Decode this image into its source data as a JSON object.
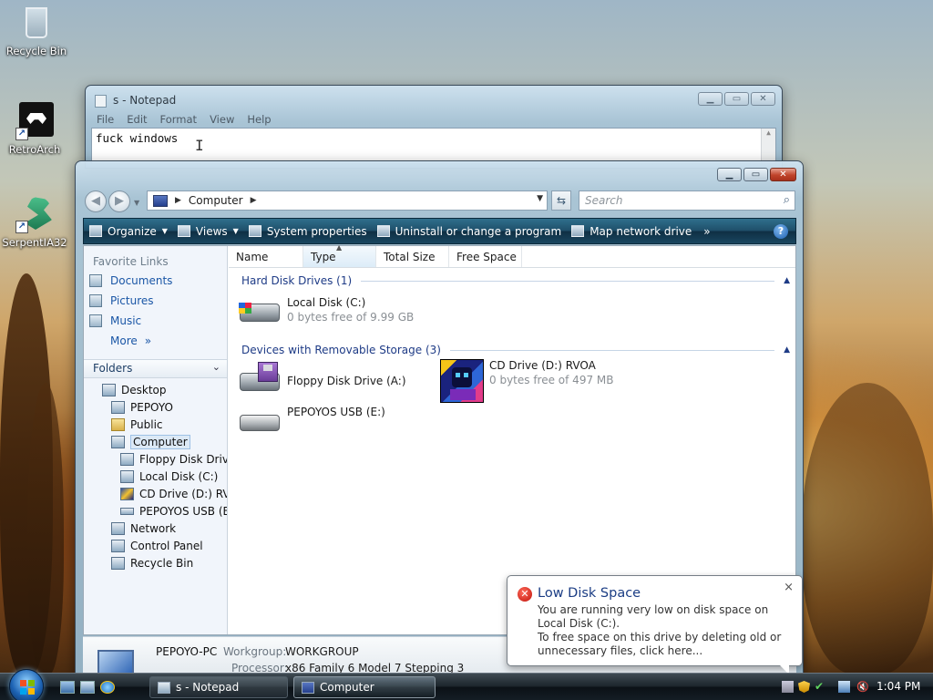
{
  "desktop": {
    "icons": [
      {
        "label": "Recycle Bin"
      },
      {
        "label": "RetroArch"
      },
      {
        "label": "SerpentIA32"
      }
    ]
  },
  "notepad": {
    "title": "s - Notepad",
    "menu": [
      "File",
      "Edit",
      "Format",
      "View",
      "Help"
    ],
    "text": "fuck windows",
    "caption_buttons": [
      "minimize",
      "maximize",
      "close"
    ]
  },
  "explorer": {
    "address": "Computer",
    "search_placeholder": "Search",
    "toolbar": [
      {
        "label": "Organize",
        "icon": "organize-icon",
        "dropdown": true
      },
      {
        "label": "Views",
        "icon": "views-icon",
        "dropdown": true
      },
      {
        "label": "System properties",
        "icon": "system-properties-icon"
      },
      {
        "label": "Uninstall or change a program",
        "icon": "uninstall-icon"
      },
      {
        "label": "Map network drive",
        "icon": "map-drive-icon"
      }
    ],
    "toolbar_more": "»",
    "favorite_links_header": "Favorite Links",
    "favorite_links": [
      "Documents",
      "Pictures",
      "Music"
    ],
    "more_label": "More",
    "folders_header": "Folders",
    "tree": [
      {
        "label": "Desktop",
        "level": 0
      },
      {
        "label": "PEPOYO",
        "level": 1
      },
      {
        "label": "Public",
        "level": 1
      },
      {
        "label": "Computer",
        "level": 1,
        "selected": true
      },
      {
        "label": "Floppy Disk Drive",
        "level": 2
      },
      {
        "label": "Local Disk (C:)",
        "level": 2
      },
      {
        "label": "CD Drive (D:) RVO",
        "level": 2
      },
      {
        "label": "PEPOYOS USB (E:)",
        "level": 2
      },
      {
        "label": "Network",
        "level": 1
      },
      {
        "label": "Control Panel",
        "level": 1
      },
      {
        "label": "Recycle Bin",
        "level": 1
      }
    ],
    "columns": [
      "Name",
      "Type",
      "Total Size",
      "Free Space"
    ],
    "sorted_column": "Type",
    "groups": [
      {
        "label": "Hard Disk Drives (1)"
      },
      {
        "label": "Devices with Removable Storage (3)"
      }
    ],
    "drives": {
      "local": {
        "name": "Local Disk (C:)",
        "sub": "0 bytes free of 9.99 GB"
      },
      "floppy": {
        "name": "Floppy Disk Drive (A:)"
      },
      "cd": {
        "name": "CD Drive (D:) RVOA",
        "sub": "0 bytes free of 497 MB"
      },
      "usb": {
        "name": "PEPOYOS USB (E:)"
      }
    },
    "details": {
      "pc_name": "PEPOYO-PC",
      "workgroup_label": "Workgroup:",
      "workgroup": "WORKGROUP",
      "processor_label": "Processor:",
      "processor": "x86 Family 6 Model 7 Stepping 3"
    }
  },
  "balloon": {
    "title": "Low Disk Space",
    "message": "You are running very low on disk space on Local Disk (C:).\nTo free space on this drive by deleting old or unnecessary files, click here...",
    "close": "×"
  },
  "taskbar": {
    "tasks": [
      {
        "label": "s - Notepad",
        "active": false
      },
      {
        "label": "Computer",
        "active": true
      }
    ],
    "clock": "1:04 PM"
  },
  "colors": {
    "accent": "#1b3d84",
    "command_bar": "#1f4f6a",
    "error": "#c0140c"
  }
}
